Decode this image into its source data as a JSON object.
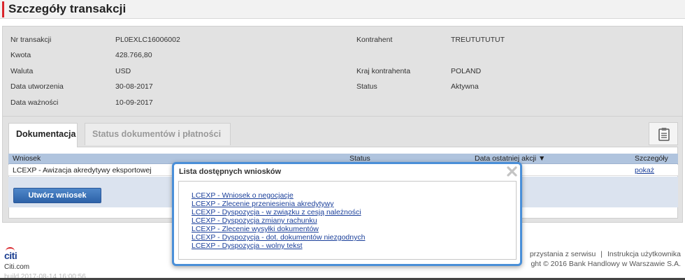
{
  "header": {
    "title": "Szczegóły transakcji"
  },
  "details": {
    "transaction_no_label": "Nr transakcji",
    "transaction_no_value": "PL0EXLC16006002",
    "amount_label": "Kwota",
    "amount_value": "428.766,80",
    "currency_label": "Waluta",
    "currency_value": "USD",
    "created_label": "Data utworzenia",
    "created_value": "30-08-2017",
    "expiry_label": "Data ważności",
    "expiry_value": "10-09-2017",
    "counterparty_label": "Kontrahent",
    "counterparty_value": "TREUTUTUTUT",
    "country_label": "Kraj kontrahenta",
    "country_value": "POLAND",
    "status_label": "Status",
    "status_value": "Aktywna"
  },
  "tabs": [
    {
      "label": "Dokumentacja",
      "active": true
    },
    {
      "label": "Status dokumentów i płatności",
      "active": false
    }
  ],
  "table": {
    "headers": [
      "Wniosek",
      "Status",
      "Data ostatniej akcji ▼",
      "Szczegóły"
    ],
    "rows": [
      {
        "wniosek": "LCEXP - Awizacja akredytywy eksportowej",
        "details_link": "pokaż"
      }
    ],
    "create_button": "Utwórz wniosek"
  },
  "modal": {
    "title": "Lista dostępnych wniosków",
    "links": [
      "LCEXP - Wniosek o negocjacje",
      "LCEXP - Zlecenie przeniesienia akredytywy",
      "LCEXP - Dyspozycja - w związku z cesją należności",
      "LCEXP - Dyspozycja zmiany rachunku",
      "LCEXP - Zlecenie wysyłki dokumentów",
      "LCEXP - Dyspozycja - dot. dokumentów niezgodnych",
      "LCEXP - Dyspozycja - wolny tekst"
    ]
  },
  "footer": {
    "logo": "citi",
    "site": "Citi.com",
    "build": "build 2017-08-14 16:00:56",
    "link_terms": "przystania z serwisu",
    "separator": "|",
    "link_manual": "Instrukcja użytkownika",
    "copyright": "ght © 2016 Bank Handlowy w Warszawie S.A."
  },
  "colors": {
    "accent_red": "#d9262c",
    "link_blue": "#1a3f9a",
    "modal_border": "#4a8fd8",
    "table_header": "#b0c4de"
  }
}
